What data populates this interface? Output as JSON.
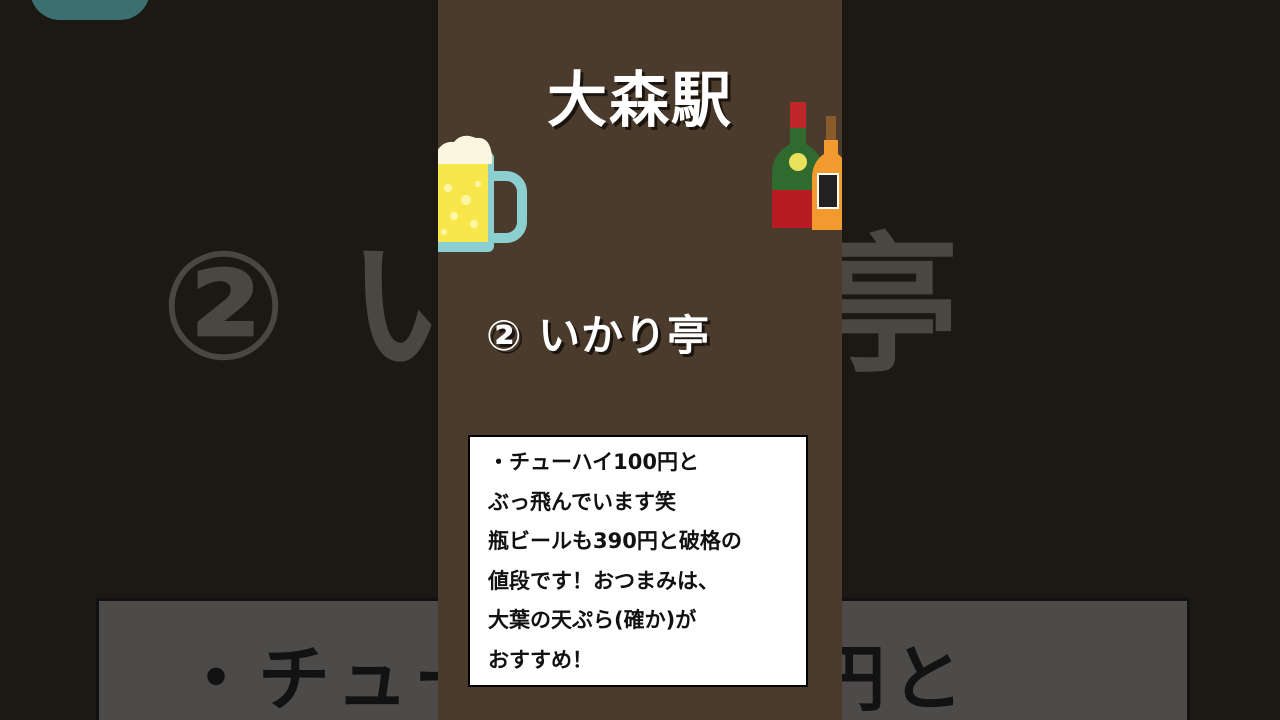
{
  "station": "大森駅",
  "shop_title": "② いかり亭",
  "description_lines": [
    "・チューハイ100円と",
    "ぶっ飛んでいます笑",
    "瓶ビールも390円と破格の",
    "値段です！おつまみは、",
    "大葉の天ぷら(確か)が",
    "おすすめ！"
  ],
  "colors": {
    "panel": "#4a3b2c",
    "text": "#ffffff",
    "box": "#ffffff"
  }
}
